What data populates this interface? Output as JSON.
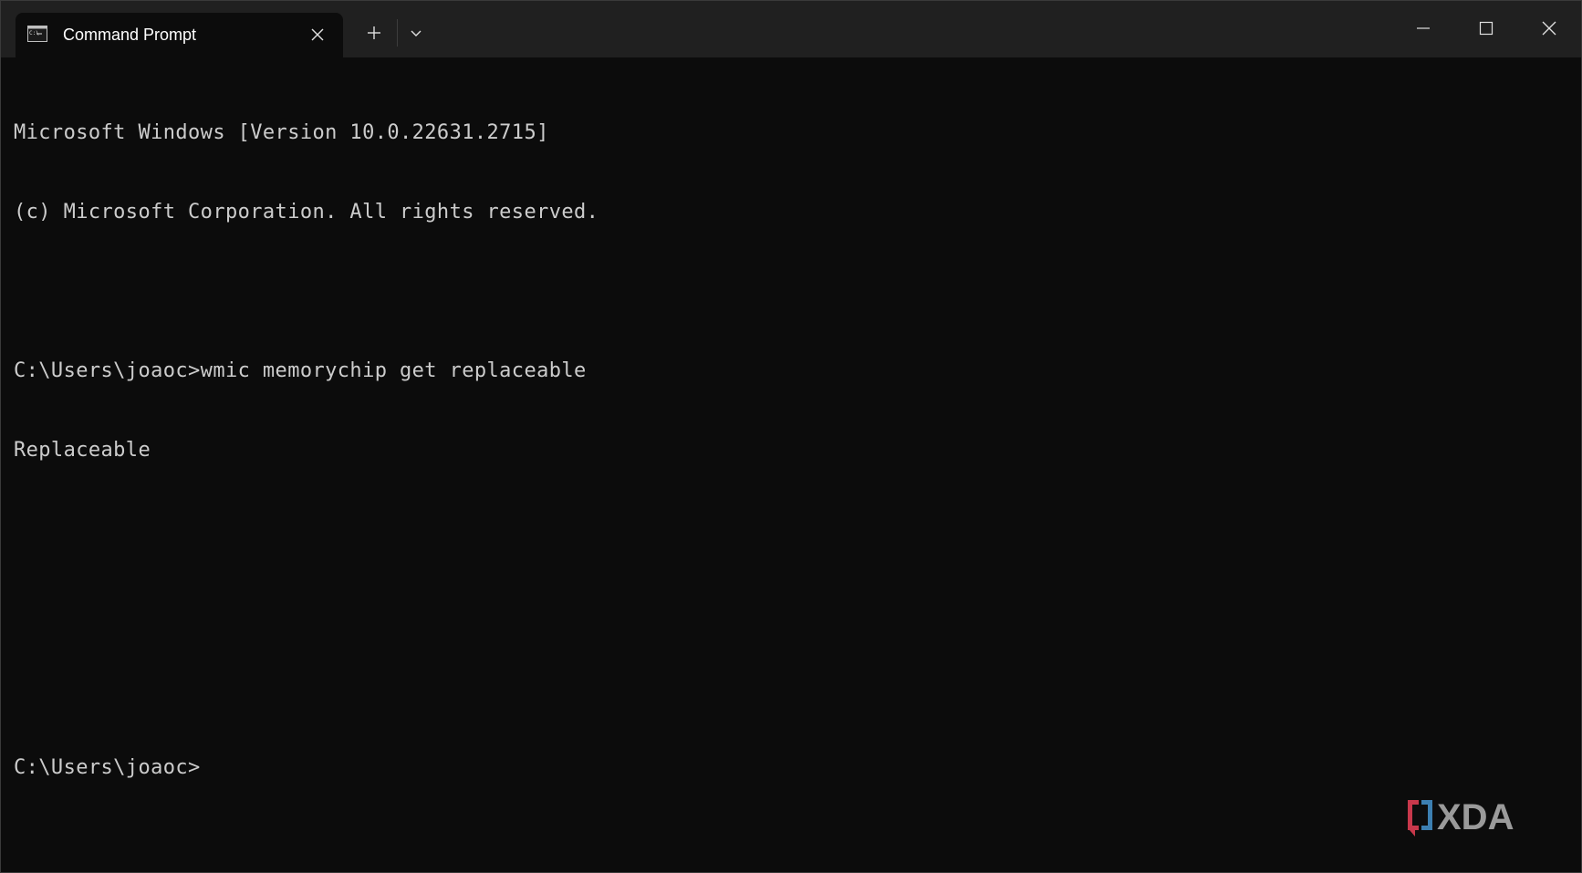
{
  "window": {
    "tab_title": "Command Prompt",
    "tab_icon": "terminal-icon",
    "colors": {
      "titlebar": "#202020",
      "background": "#0c0c0c",
      "text": "#cccccc"
    }
  },
  "terminal": {
    "lines": [
      "Microsoft Windows [Version 10.0.22631.2715]",
      "(c) Microsoft Corporation. All rights reserved.",
      "",
      "C:\\Users\\joaoc>wmic memorychip get replaceable",
      "Replaceable",
      "",
      "",
      "",
      "C:\\Users\\joaoc>"
    ]
  },
  "watermark": {
    "text": "XDA",
    "colors": {
      "bracket_left": "#c8384b",
      "bracket_right": "#3c7fb1",
      "letters": "#9a9a9a"
    }
  }
}
